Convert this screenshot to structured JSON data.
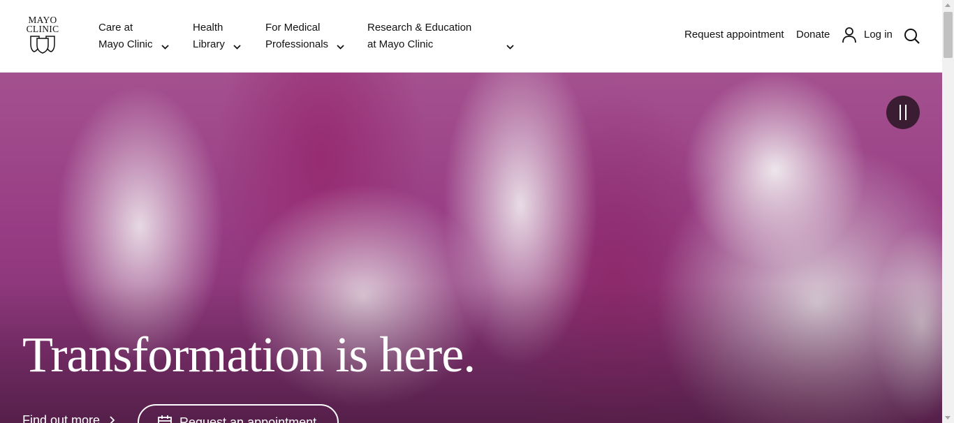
{
  "logo": {
    "line1": "MAYO",
    "line2": "CLINIC",
    "icon": "mayo-shield-icon"
  },
  "nav": [
    {
      "line1": "Care at",
      "line2": "Mayo Clinic"
    },
    {
      "line1": "Health",
      "line2": "Library"
    },
    {
      "line1": "For Medical",
      "line2": "Professionals"
    },
    {
      "line1": "Research & Education",
      "line2": "at Mayo Clinic"
    }
  ],
  "utility": {
    "request_appointment": "Request appointment",
    "donate": "Donate",
    "login": "Log in",
    "login_icon": "user-icon",
    "search_icon": "search-icon"
  },
  "hero": {
    "headline": "Transformation is here.",
    "find_more": "Find out more",
    "appointment_button": "Request an appointment",
    "appointment_icon": "calendar-icon",
    "pause_icon": "pause-icon"
  },
  "colors": {
    "hero_magenta": "#973c84",
    "pause_bg": "#3b1d33"
  }
}
